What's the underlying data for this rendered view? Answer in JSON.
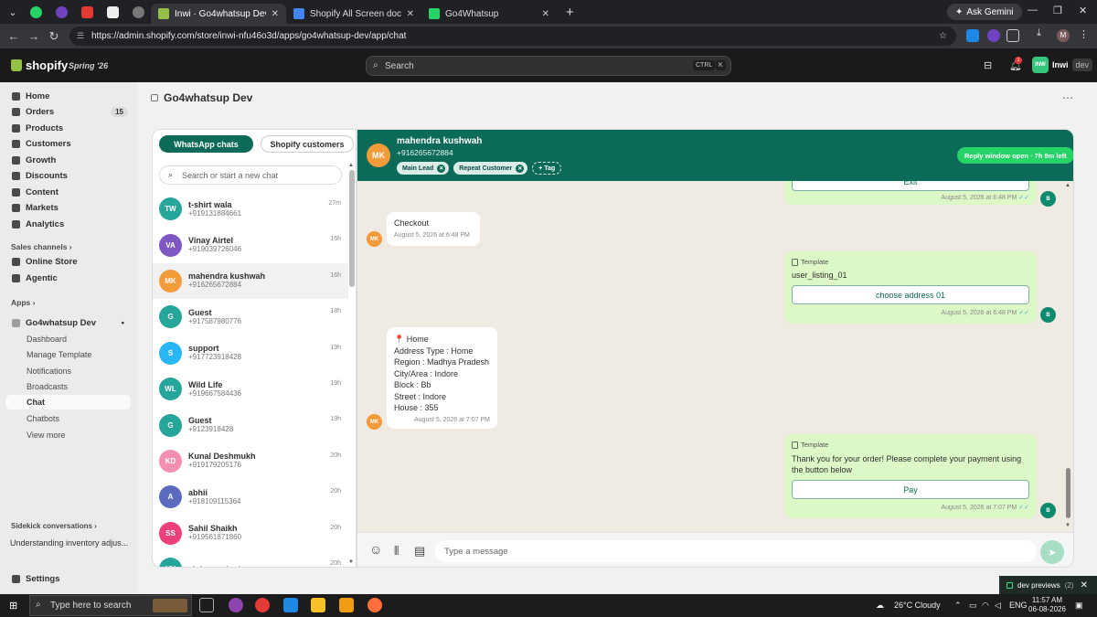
{
  "browser": {
    "tabs": [
      {
        "title": "Inwi · Go4whatsup Dev · Shopify",
        "active": true,
        "favicon_color": "#95bf47"
      },
      {
        "title": "Shopify All Screen doc - Google",
        "active": false,
        "favicon_color": "#4285f4"
      },
      {
        "title": "Go4Whatsup",
        "active": false,
        "favicon_color": "#25d366"
      }
    ],
    "ask_gemini": "Ask Gemini",
    "url": "https://admin.shopify.com/store/inwi-nfu46o3d/apps/go4whatsup-dev/app/chat",
    "profile_initial": "M"
  },
  "shopify": {
    "logo_text": "shopify",
    "edition": "Spring '26",
    "search_placeholder": "Search",
    "kbd_ctrl": "CTRL",
    "kbd_k": "K",
    "notification_count": "1",
    "store_initials": "INW",
    "store_name": "Inwi",
    "store_badge": "dev"
  },
  "sidebar": {
    "nav": [
      {
        "label": "Home"
      },
      {
        "label": "Orders",
        "count": "15"
      },
      {
        "label": "Products"
      },
      {
        "label": "Customers"
      },
      {
        "label": "Growth"
      },
      {
        "label": "Discounts"
      },
      {
        "label": "Content"
      },
      {
        "label": "Markets"
      },
      {
        "label": "Analytics"
      }
    ],
    "sales_channels_header": "Sales channels",
    "sales_channels": [
      {
        "label": "Online Store"
      },
      {
        "label": "Agentic"
      }
    ],
    "apps_header": "Apps",
    "app_name": "Go4whatsup Dev",
    "app_pages": [
      "Dashboard",
      "Manage Template",
      "Notifications",
      "Broadcasts",
      "Chat",
      "Chatbots",
      "View more"
    ],
    "sidekick_header": "Sidekick conversations",
    "sidekick_item": "Understanding inventory adjus...",
    "settings": "Settings"
  },
  "page": {
    "title": "Go4whatsup Dev"
  },
  "chatlist": {
    "tab_whatsapp": "WhatsApp chats",
    "tab_shopify": "Shopify customers",
    "search_placeholder": "Search or start a new chat",
    "chats": [
      {
        "initials": "TW",
        "name": "t-shirt wala",
        "phone": "+919131884661",
        "time": "27m",
        "color": "#26a69a"
      },
      {
        "initials": "VA",
        "name": "Vinay Airtel",
        "phone": "+919039726046",
        "time": "16h",
        "color": "#7e57c2"
      },
      {
        "initials": "MK",
        "name": "mahendra kushwah",
        "phone": "+916265672884",
        "time": "16h",
        "color": "#f29b38",
        "selected": true
      },
      {
        "initials": "G",
        "name": "Guest",
        "phone": "+917587980776",
        "time": "18h",
        "color": "#26a69a"
      },
      {
        "initials": "S",
        "name": "support",
        "phone": "+917723918428",
        "time": "19h",
        "color": "#29b6f6"
      },
      {
        "initials": "WL",
        "name": "Wild Life",
        "phone": "+919667584436",
        "time": "19h",
        "color": "#26a69a"
      },
      {
        "initials": "G",
        "name": "Guest",
        "phone": "+9123918428",
        "time": "19h",
        "color": "#26a69a"
      },
      {
        "initials": "KD",
        "name": "Kunal Deshmukh",
        "phone": "+919179205176",
        "time": "20h",
        "color": "#f48fb1"
      },
      {
        "initials": "A",
        "name": "abhii",
        "phone": "+918109115364",
        "time": "20h",
        "color": "#5c6bc0"
      },
      {
        "initials": "SS",
        "name": "Sahil Shaikh",
        "phone": "+919561871860",
        "time": "20h",
        "color": "#ec407a"
      },
      {
        "initials": "VV",
        "name": "vishnu vajpai",
        "phone": "",
        "time": "20h",
        "color": "#26a69a"
      }
    ]
  },
  "conversation": {
    "initials": "MK",
    "name": "mahendra kushwah",
    "phone": "+916265672884",
    "tags": [
      "Main Lead",
      "Repeat Customer"
    ],
    "add_tag": "+ Tag",
    "reply_window": "Reply window open · 7h 9m left",
    "messages": {
      "m0_button": "Exit",
      "m0_time": "August 5, 2026 at 6:48 PM",
      "m1_text": "Checkout",
      "m1_time": "August 5, 2026 at 6:48 PM",
      "m2_label": "Template",
      "m2_text": "user_listing_01",
      "m2_button": "choose address 01",
      "m2_time": "August 5, 2026 at 6:48 PM",
      "m3_lines": [
        "📍 Home",
        "Address Type : Home",
        "Region : Madhya Pradesh",
        "City/Area : Indore",
        "Block : Bb",
        "Street : Indore",
        "House : 355"
      ],
      "m3_time": "August 5, 2026 at 7:07 PM",
      "m4_label": "Template",
      "m4_text": "Thank you for your order! Please complete your payment using the button below",
      "m4_button": "Pay",
      "m4_time": "August 5, 2026 at 7:07 PM",
      "sender_in": "MK",
      "sender_out": "B",
      "ticks": "✓✓"
    },
    "input_placeholder": "Type a message"
  },
  "devpreviews": {
    "label": "dev previews",
    "count": "(2)"
  },
  "taskbar": {
    "search_placeholder": "Type here to search",
    "weather": "26°C  Cloudy",
    "lang": "ENG",
    "time": "11:57 AM",
    "date": "06-08-2026"
  }
}
